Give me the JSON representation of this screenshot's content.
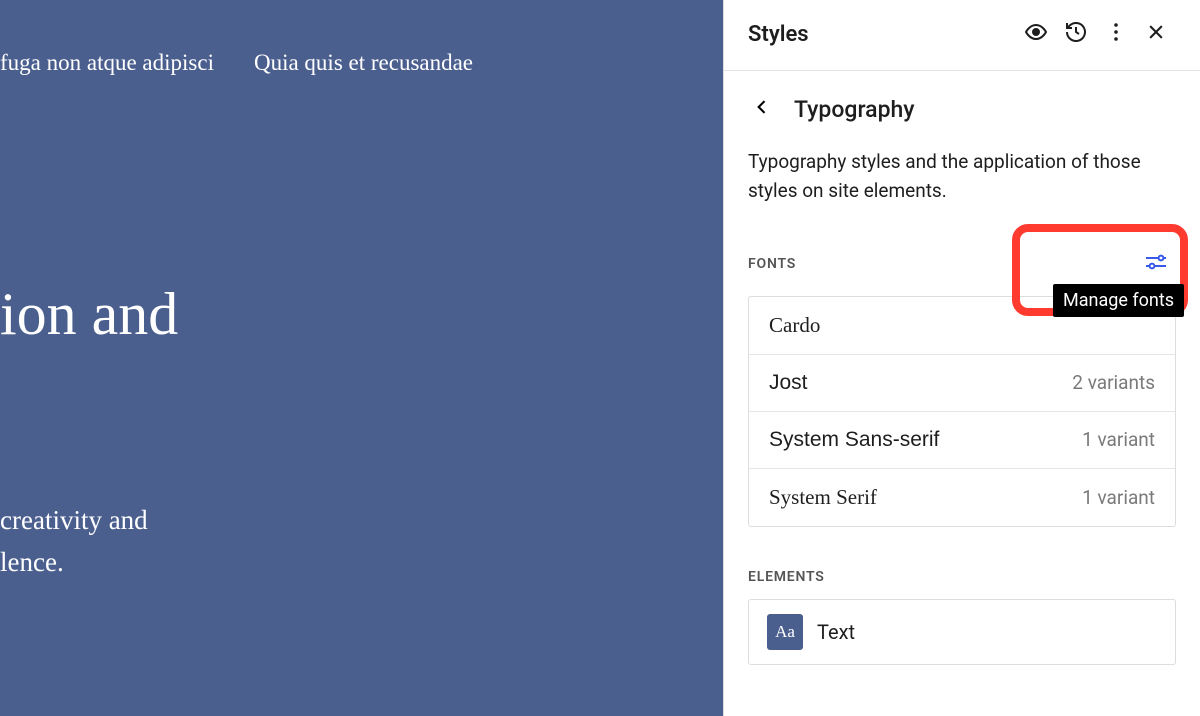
{
  "canvas": {
    "nav1": "fuga non atque adipisci",
    "nav2": "Quia quis et recusandae",
    "hero": "ion and",
    "sub1": "creativity and",
    "sub2": "lence."
  },
  "header": {
    "title": "Styles"
  },
  "crumb": {
    "title": "Typography"
  },
  "description": "Typography styles and the application of those styles on site elements.",
  "fonts": {
    "heading": "FONTS",
    "tooltip": "Manage fonts",
    "items": [
      {
        "name": "Cardo",
        "variants": "",
        "family": "serif"
      },
      {
        "name": "Jost",
        "variants": "2 variants",
        "family": "sans"
      },
      {
        "name": "System Sans-serif",
        "variants": "1 variant",
        "family": "sans"
      },
      {
        "name": "System Serif",
        "variants": "1 variant",
        "family": "serif"
      }
    ]
  },
  "elements": {
    "heading": "ELEMENTS",
    "items": [
      {
        "badge": "Aa",
        "label": "Text"
      }
    ]
  }
}
